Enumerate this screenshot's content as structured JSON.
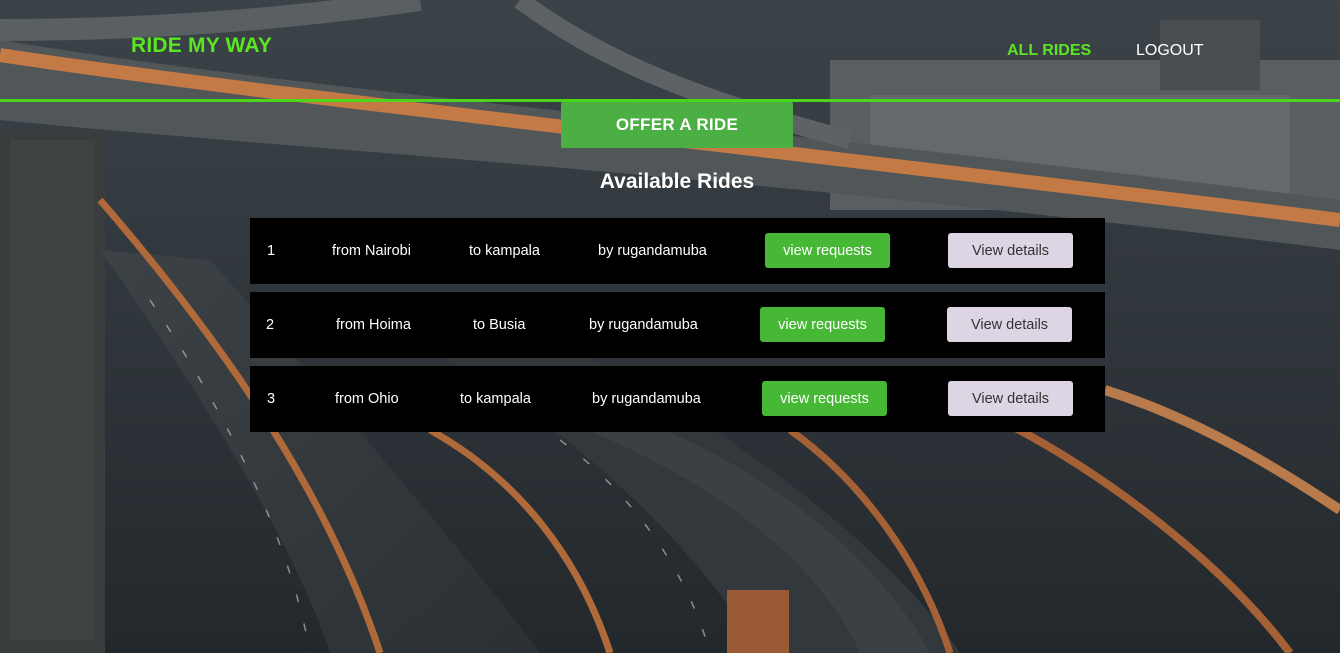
{
  "header": {
    "brand": "RIDE MY WAY",
    "nav": {
      "all_rides": "ALL RIDES",
      "logout": "LOGOUT"
    }
  },
  "actions": {
    "offer_ride": "OFFER A RIDE"
  },
  "section_title": "Available Rides",
  "rides": [
    {
      "id": "1",
      "from": "from Nairobi",
      "to": "to kampala",
      "by": "by rugandamuba",
      "requests_label": "view requests",
      "details_label": "View details"
    },
    {
      "id": "2",
      "from": "from Hoima",
      "to": "to Busia",
      "by": "by rugandamuba",
      "requests_label": "view requests",
      "details_label": "View details"
    },
    {
      "id": "3",
      "from": "from Ohio",
      "to": "to kampala",
      "by": "by rugandamuba",
      "requests_label": "view requests",
      "details_label": "View details"
    }
  ],
  "colors": {
    "accent_green": "#5be61f",
    "button_green": "#4caf43",
    "details_button": "#ddd5e3",
    "row_background": "#000000"
  }
}
